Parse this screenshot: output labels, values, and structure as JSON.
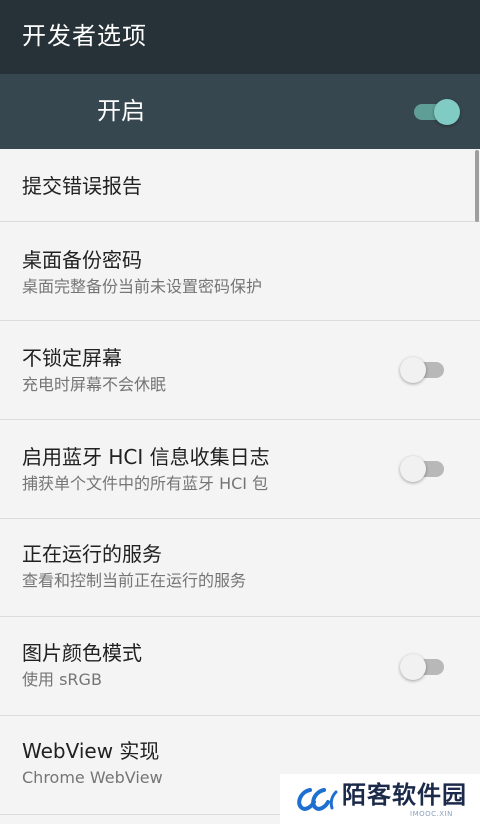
{
  "appbar": {
    "title": "开发者选项"
  },
  "master_switch": {
    "label": "开启",
    "state": "on"
  },
  "colors": {
    "appbar_bg": "#263238",
    "master_bg": "#37474f",
    "accent": "#80cbc4",
    "list_bg": "#f4f4f4"
  },
  "items": [
    {
      "title": "提交错误报告",
      "subtitle": ""
    },
    {
      "title": "桌面备份密码",
      "subtitle": "桌面完整备份当前未设置密码保护"
    },
    {
      "title": "不锁定屏幕",
      "subtitle": "充电时屏幕不会休眠",
      "toggle": "off"
    },
    {
      "title": "启用蓝牙 HCI 信息收集日志",
      "subtitle": "捕获单个文件中的所有蓝牙 HCI 包",
      "toggle": "off"
    },
    {
      "title": "正在运行的服务",
      "subtitle": "查看和控制当前正在运行的服务"
    },
    {
      "title": "图片颜色模式",
      "subtitle": "使用 sRGB",
      "toggle": "off"
    },
    {
      "title": "WebView 实现",
      "subtitle": "Chrome WebView"
    }
  ],
  "watermark": {
    "text": "陌客软件园",
    "sub": "IMOOC.XIN"
  }
}
